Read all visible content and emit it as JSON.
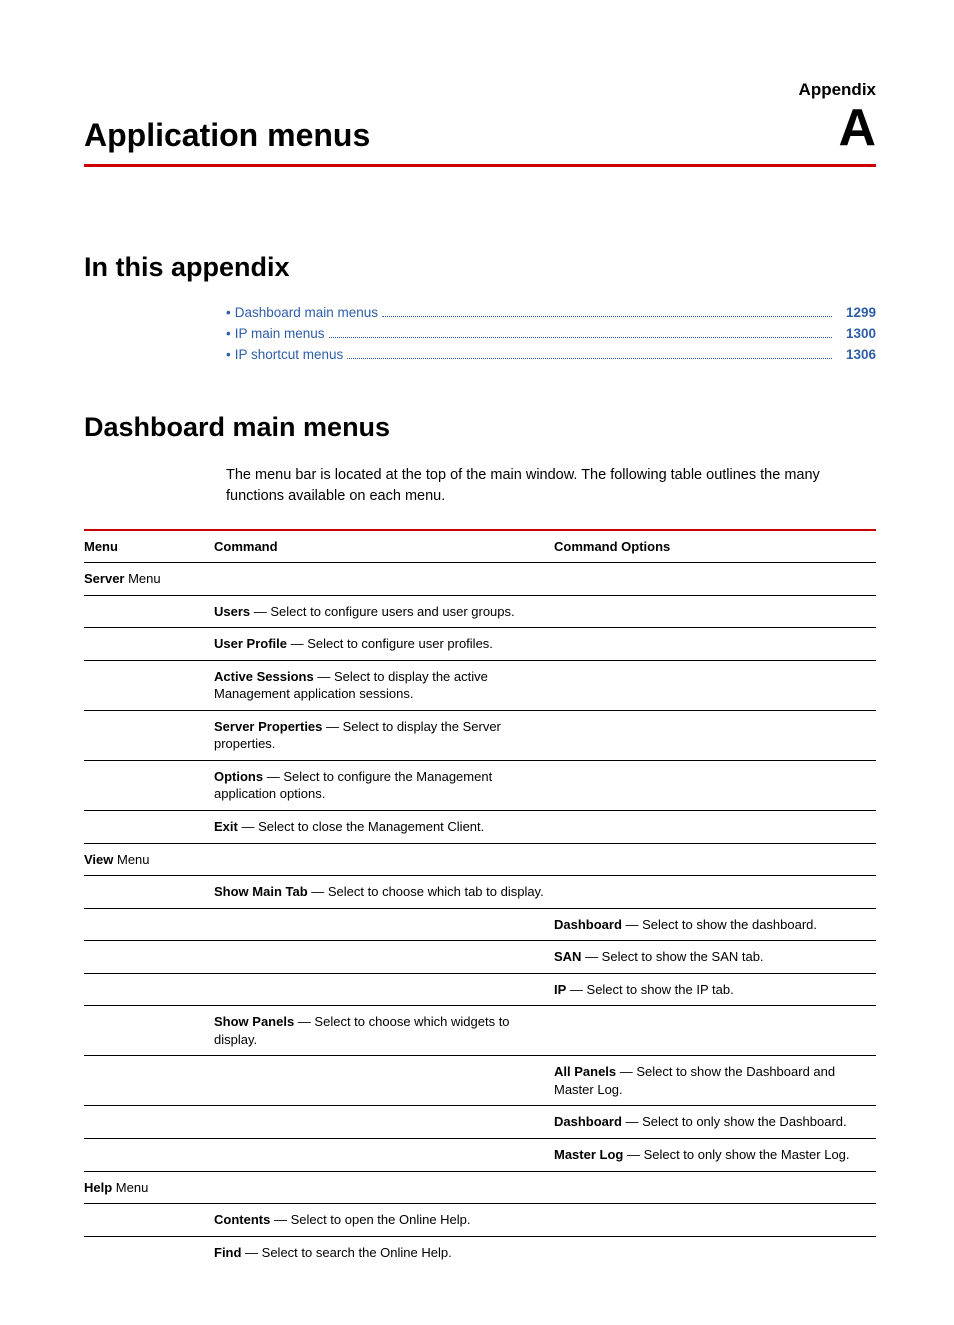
{
  "header": {
    "appendix_label": "Appendix",
    "title": "Application menus",
    "letter": "A"
  },
  "sections": {
    "in_this_appendix": "In this appendix",
    "dashboard_main": "Dashboard main menus"
  },
  "toc": [
    {
      "label": "Dashboard main menus",
      "page": "1299"
    },
    {
      "label": "IP main menus",
      "page": "1300"
    },
    {
      "label": "IP shortcut menus",
      "page": "1306"
    }
  ],
  "intro": "The menu bar is located at the top of the main window. The following table outlines the many functions available on each menu.",
  "table": {
    "headers": {
      "menu": "Menu",
      "command": "Command",
      "options": "Command Options"
    },
    "groups": [
      {
        "menu_bold": "Server",
        "menu_rest": " Menu",
        "rows": [
          {
            "cmd_b": "Users",
            "cmd_t": " — Select to configure users and user groups."
          },
          {
            "cmd_b": "User Profile",
            "cmd_t": " — Select to configure user profiles."
          },
          {
            "cmd_b": "Active Sessions",
            "cmd_t": " — Select to display the active Management application sessions."
          },
          {
            "cmd_b": "Server Properties",
            "cmd_t": " — Select to display the Server properties."
          },
          {
            "cmd_b": "Options",
            "cmd_t": " — Select to configure the Management application options."
          },
          {
            "cmd_b": "Exit",
            "cmd_t": " — Select to close the Management Client."
          }
        ]
      },
      {
        "menu_bold": "View",
        "menu_rest": " Menu",
        "rows": [
          {
            "cmd_b": "Show Main Tab",
            "cmd_t": " — Select to choose which tab to display."
          },
          {
            "opt_b": "Dashboard",
            "opt_t": " — Select to show the dashboard."
          },
          {
            "opt_b": "SAN",
            "opt_t": " — Select to show the SAN tab."
          },
          {
            "opt_b": "IP",
            "opt_t": " — Select to show the IP tab."
          },
          {
            "cmd_b": "Show Panels",
            "cmd_t": " — Select to choose which widgets to display."
          },
          {
            "opt_b": "All Panels",
            "opt_t": " — Select to show the Dashboard and Master Log."
          },
          {
            "opt_b": "Dashboard",
            "opt_t": " — Select to only show the Dashboard."
          },
          {
            "opt_b": "Master Log",
            "opt_t": " — Select to only show the Master Log."
          }
        ]
      },
      {
        "menu_bold": "Help",
        "menu_rest": " Menu",
        "rows": [
          {
            "cmd_b": "Contents",
            "cmd_t": " — Select to open the Online Help."
          },
          {
            "cmd_b": "Find",
            "cmd_t": " — Select to search the Online Help.",
            "no_line": true
          }
        ]
      }
    ]
  }
}
